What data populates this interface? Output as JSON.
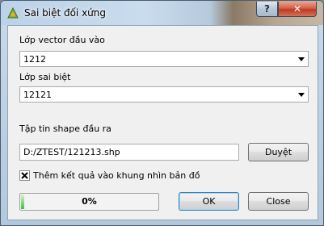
{
  "window": {
    "title": "Sai biệt đối xứng",
    "help_glyph": "?",
    "close_glyph": "✕"
  },
  "form": {
    "input_layer": {
      "label": "Lớp vector đầu vào",
      "value": "1212"
    },
    "diff_layer": {
      "label": "Lớp sai biệt",
      "value": "12121"
    },
    "output": {
      "label": "Tập tin shape đầu ra",
      "value": "D:/ZTEST/121213.shp",
      "browse_label": "Duyệt"
    },
    "add_to_canvas": {
      "label": "Thêm kết quả vào khung nhìn bản đồ",
      "checked": true
    }
  },
  "progress": {
    "value": 0,
    "text": "0%"
  },
  "buttons": {
    "ok_label": "OK",
    "close_label": "Close"
  }
}
